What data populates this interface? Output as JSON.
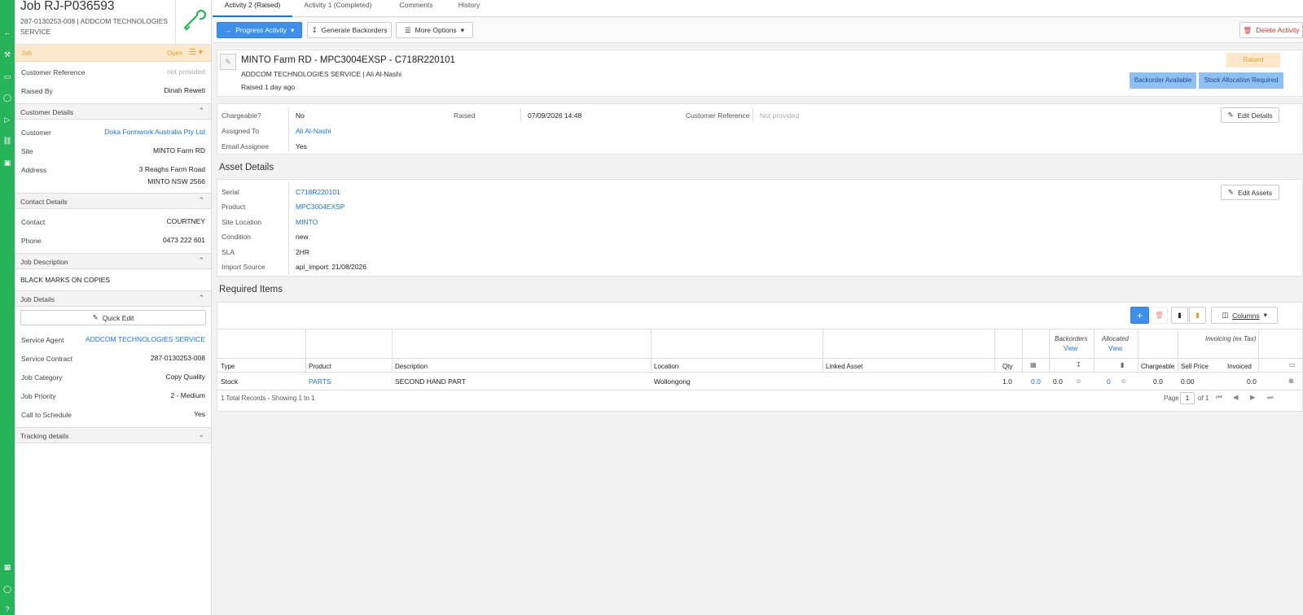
{
  "rail": {
    "icons": [
      "back-arrow-icon",
      "wrench-icon",
      "card-icon",
      "user-icon",
      "tag-icon",
      "truck-icon",
      "dollar-icon"
    ],
    "bottom_icons": [
      "grid-icon",
      "person-icon",
      "help-icon"
    ]
  },
  "sidebar": {
    "job_title": "Job RJ-P036593",
    "job_subtitle": "287-0130253-008 | ADDCOM TECHNOLOGIES SERVICE",
    "status_bar": {
      "label": "Job",
      "status": "Open"
    },
    "top_rows": [
      {
        "label": "Customer Reference",
        "value": "not provided"
      },
      {
        "label": "Raised By",
        "value": "Dinah Reweti"
      }
    ],
    "customer_details": {
      "title": "Customer Details",
      "customer_label": "Customer",
      "customer_value": "Doka Formwork Australia Pty Ltd",
      "site_label": "Site",
      "site_value": "MINTO Farm RD",
      "address_label": "Address",
      "address_line1": "3 Reaghs Farm Road",
      "address_line2": "MINTO NSW 2566"
    },
    "contact_details": {
      "title": "Contact Details",
      "contact_label": "Contact",
      "contact_value": "COURTNEY",
      "phone_label": "Phone",
      "phone_value": "0473 222 601"
    },
    "job_description": {
      "title": "Job Description",
      "text": "BLACK MARKS ON COPIES"
    },
    "job_details": {
      "title": "Job Details",
      "quick_edit": "Quick Edit",
      "rows": [
        {
          "label": "Service Agent",
          "value": "ADDCOM TECHNOLOGIES SERVICE"
        },
        {
          "label": "Service Contract",
          "value": "287-0130253-008"
        },
        {
          "label": "Job Category",
          "value": "Copy Quality"
        },
        {
          "label": "Job Priority",
          "value": "2 - Medium"
        },
        {
          "label": "Call to Schedule",
          "value": "Yes"
        }
      ]
    },
    "tracking": {
      "title": "Tracking details"
    }
  },
  "tabs": [
    "Activity 2  (Raised)",
    "Activity 1  (Completed)",
    "Comments",
    "History"
  ],
  "toolbar": {
    "progress": "Progress Activity",
    "backorders": "Generate Backorders",
    "more": "More Options",
    "delete": "Delete Activity"
  },
  "header": {
    "title": "MINTO Farm RD - MPC3004EXSP - C718R220101",
    "subtitle": "ADDCOM TECHNOLOGIES SERVICE | Ali Al-Nashi",
    "raised": "Raised 1 day ago",
    "status": "Raised",
    "badge1": "Backorder Available",
    "badge2": "Stock Allocation Required"
  },
  "details": {
    "chargeable_label": "Chargeable?",
    "chargeable_value": "No",
    "assigned_label": "Assigned To",
    "assigned_value": "Ali Al-Nashi",
    "email_label": "Email Assignee",
    "email_value": "Yes",
    "raised_label": "Raised",
    "raised_value": "07/09/2026 14:48",
    "custref_label": "Customer Reference",
    "custref_value": "Not provided",
    "edit": "Edit Details"
  },
  "asset": {
    "title": "Asset Details",
    "edit": "Edit Assets",
    "rows": [
      {
        "label": "Serial",
        "value": "C718R220101"
      },
      {
        "label": "Product",
        "value": "MPC3004EXSP"
      },
      {
        "label": "Site Location",
        "value": "MINTO"
      },
      {
        "label": "Condition",
        "value": "new"
      },
      {
        "label": "SLA",
        "value": "2HR"
      },
      {
        "label": "Import Source",
        "value": "api_import: 21/08/2026"
      }
    ]
  },
  "required": {
    "title": "Required Items",
    "columns_btn": "Columns",
    "group_backorders": "Backorders",
    "group_allocated": "Allocated",
    "group_invoicing": "Invoicing (ex Tax)",
    "view": "View",
    "headers": [
      "Type",
      "Product",
      "Description",
      "Location",
      "Linked Asset",
      "Qty",
      "Chargeable",
      "Sell Price",
      "Invoiced"
    ],
    "row": {
      "type": "Stock",
      "product": "PARTS",
      "description": "SECOND HAND PART",
      "location": "Wollongong",
      "qty": "1.0",
      "stock": "0.0",
      "backorders": "0.0",
      "allocated": "0",
      "chargeable": "0.0",
      "sell": "0.00",
      "invoiced": "0.0"
    },
    "footer": "1 Total Records - Showing 1 to 1",
    "page_label": "Page",
    "page_value": "1",
    "page_of": "of 1"
  }
}
